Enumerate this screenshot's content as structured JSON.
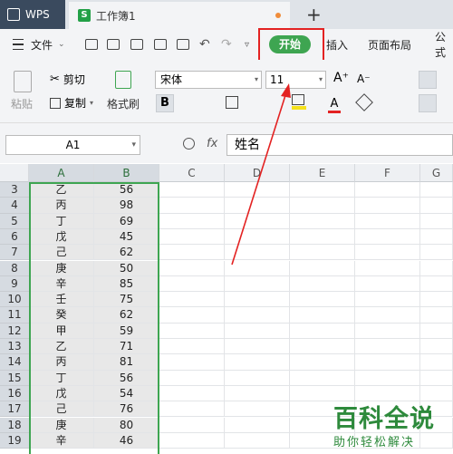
{
  "titlebar": {
    "app_tab": "WPS",
    "doc_tab": "工作簿1",
    "new_tab": "+"
  },
  "menubar": {
    "file": "文件",
    "start": "开始",
    "insert": "插入",
    "page_layout": "页面布局",
    "formula": "公式"
  },
  "ribbon": {
    "paste": "粘贴",
    "cut": "剪切",
    "copy": "复制",
    "format_painter": "格式刷",
    "font_name": "宋体",
    "font_size": "11",
    "bold": "B",
    "grow_font": "A⁺",
    "shrink_font": "A⁻",
    "underline": "U",
    "font_color": "A"
  },
  "formula_bar": {
    "cell_ref": "A1",
    "fx": "fx",
    "value": "姓名"
  },
  "sheet": {
    "columns": [
      "A",
      "B",
      "C",
      "D",
      "E",
      "F",
      "G"
    ],
    "rows": [
      {
        "n": "3",
        "a": "乙",
        "b": "56"
      },
      {
        "n": "4",
        "a": "丙",
        "b": "98"
      },
      {
        "n": "5",
        "a": "丁",
        "b": "69"
      },
      {
        "n": "6",
        "a": "戊",
        "b": "45"
      },
      {
        "n": "7",
        "a": "己",
        "b": "62"
      },
      {
        "n": "8",
        "a": "庚",
        "b": "50"
      },
      {
        "n": "9",
        "a": "辛",
        "b": "85"
      },
      {
        "n": "10",
        "a": "壬",
        "b": "75"
      },
      {
        "n": "11",
        "a": "癸",
        "b": "62"
      },
      {
        "n": "12",
        "a": "甲",
        "b": "59"
      },
      {
        "n": "13",
        "a": "乙",
        "b": "71"
      },
      {
        "n": "14",
        "a": "丙",
        "b": "81"
      },
      {
        "n": "15",
        "a": "丁",
        "b": "56"
      },
      {
        "n": "16",
        "a": "戊",
        "b": "54"
      },
      {
        "n": "17",
        "a": "己",
        "b": "76"
      },
      {
        "n": "18",
        "a": "庚",
        "b": "80"
      },
      {
        "n": "19",
        "a": "辛",
        "b": "46"
      }
    ]
  },
  "watermark": {
    "title": "百科全说",
    "subtitle": "助你轻松解决"
  },
  "colors": {
    "accent_green": "#3ea551",
    "highlight_red": "#e32222"
  }
}
